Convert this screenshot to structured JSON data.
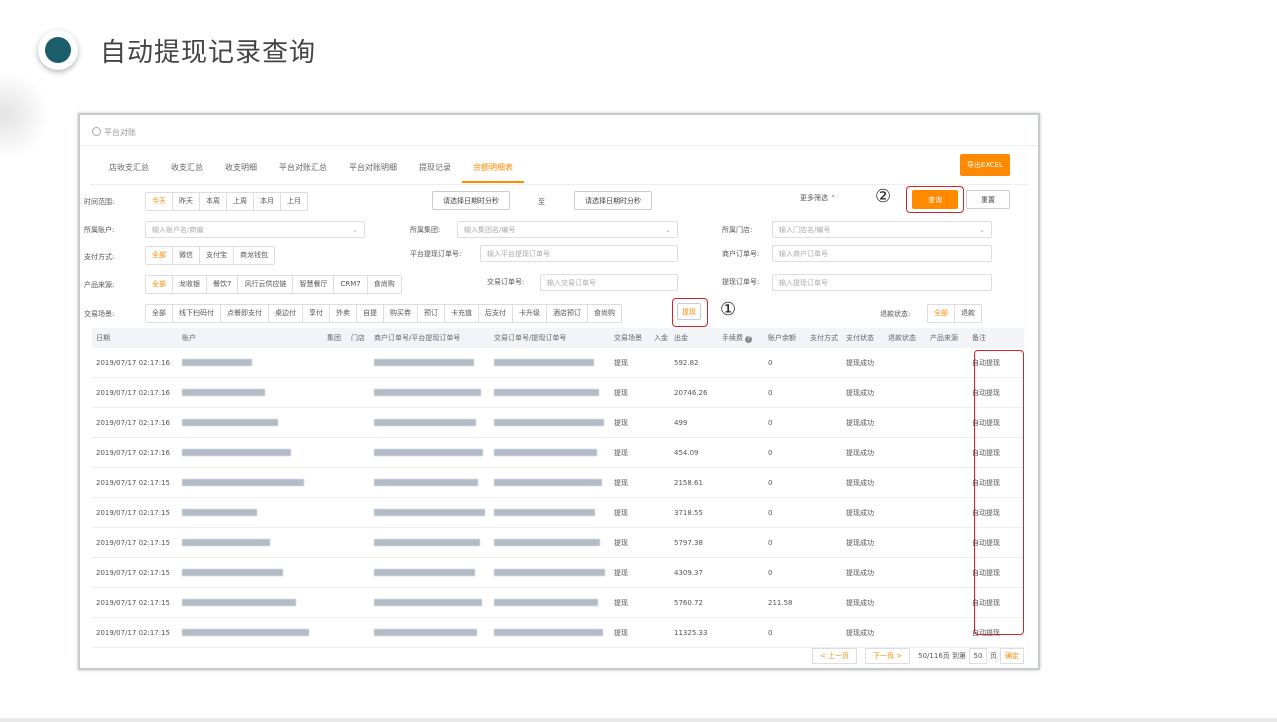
{
  "page_title": "自动提现记录查询",
  "breadcrumb": "平台对账",
  "tabs": [
    "店收支汇总",
    "收支汇总",
    "收支明细",
    "平台对账汇总",
    "平台对账明细",
    "提现记录",
    "余额明细表"
  ],
  "active_tab": 6,
  "export_label": "导出EXCEL",
  "filters": {
    "time_label": "时间范围:",
    "time_options": [
      "今天",
      "昨天",
      "本周",
      "上周",
      "本月",
      "上月"
    ],
    "start_placeholder": "请选择日期时分秒",
    "to_label": "至",
    "end_placeholder": "请选择日期时分秒",
    "more_filter": "更多筛选 ⌃",
    "query_label": "查询",
    "reset_label": "重置",
    "account_label": "所属账户:",
    "account_placeholder": "输入账户名/商编",
    "group_label": "所属集团:",
    "group_placeholder": "输入集团名/编号",
    "store_label": "所属门店:",
    "store_placeholder": "输入门店名/编号",
    "pay_label": "支付方式:",
    "pay_options": [
      "全部",
      "微信",
      "支付宝",
      "商龙钱包"
    ],
    "platform_order_label": "平台提现订单号:",
    "platform_order_placeholder": "输入平台提现订单号",
    "merchant_order_label": "商户订单号:",
    "merchant_order_placeholder": "输入商户订单号",
    "source_label": "产品来源:",
    "source_options": [
      "全部",
      "龙收银",
      "餐饮7",
      "风行云供应链",
      "智慧餐厅",
      "CRM7",
      "食尚购"
    ],
    "trade_order_label": "交易订单号:",
    "trade_order_placeholder": "输入交易订单号",
    "withdraw_order_label": "提现订单号:",
    "withdraw_order_placeholder": "输入提现订单号",
    "scene_label": "交易场景:",
    "scene_options": [
      "全部",
      "线下扫码付",
      "点餐即支付",
      "桌边付",
      "享付",
      "外卖",
      "自提",
      "购买券",
      "预订",
      "卡充值",
      "后支付",
      "卡升级",
      "酒店预订",
      "食尚购",
      "提现"
    ],
    "refund_label": "退款状态:",
    "refund_options": [
      "全部",
      "退款"
    ]
  },
  "annotations": [
    "①",
    "②"
  ],
  "table": {
    "columns": [
      "日期",
      "账户",
      "集团",
      "门店",
      "商户订单号/平台提现订单号",
      "交易订单号/提现订单号",
      "交易场景",
      "入金",
      "出金",
      "手续费",
      "账户余额",
      "支付方式",
      "支付状态",
      "退款状态",
      "产品来源",
      "备注"
    ],
    "rows": [
      {
        "date": "2019/07/17 02:17:16",
        "scene": "提现",
        "out": "592.82",
        "balance": "0",
        "status": "提现成功",
        "note": "自动提现"
      },
      {
        "date": "2019/07/17 02:17:16",
        "scene": "提现",
        "out": "20746.26",
        "balance": "0",
        "status": "提现成功",
        "note": "自动提现"
      },
      {
        "date": "2019/07/17 02:17:16",
        "scene": "提现",
        "out": "499",
        "balance": "0",
        "status": "提现成功",
        "note": "自动提现"
      },
      {
        "date": "2019/07/17 02:17:16",
        "scene": "提现",
        "out": "454.09",
        "balance": "0",
        "status": "提现成功",
        "note": "自动提现"
      },
      {
        "date": "2019/07/17 02:17:15",
        "scene": "提现",
        "out": "2158.61",
        "balance": "0",
        "status": "提现成功",
        "note": "自动提现"
      },
      {
        "date": "2019/07/17 02:17:15",
        "scene": "提现",
        "out": "3718.55",
        "balance": "0",
        "status": "提现成功",
        "note": "自动提现"
      },
      {
        "date": "2019/07/17 02:17:15",
        "scene": "提现",
        "out": "5797.38",
        "balance": "0",
        "status": "提现成功",
        "note": "自动提现"
      },
      {
        "date": "2019/07/17 02:17:15",
        "scene": "提现",
        "out": "4309.37",
        "balance": "0",
        "status": "提现成功",
        "note": "自动提现"
      },
      {
        "date": "2019/07/17 02:17:15",
        "scene": "提现",
        "out": "5760.72",
        "balance": "211.58",
        "status": "提现成功",
        "note": "自动提现"
      },
      {
        "date": "2019/07/17 02:17:15",
        "scene": "提现",
        "out": "11325.33",
        "balance": "0",
        "status": "提现成功",
        "note": "自动提现"
      }
    ]
  },
  "pager": {
    "prev": "< 上一页",
    "next": "下一页 >",
    "info": "50/116页 到第",
    "page_input": "50",
    "page_unit": "页",
    "go": "确定"
  },
  "colors": {
    "accent": "#ff8a00",
    "annotation_red": "#d2232a",
    "title_dot": "#1c5d6b"
  },
  "icons": [
    "user-icon",
    "help-icon",
    "dropdown-arrow-icon"
  ]
}
